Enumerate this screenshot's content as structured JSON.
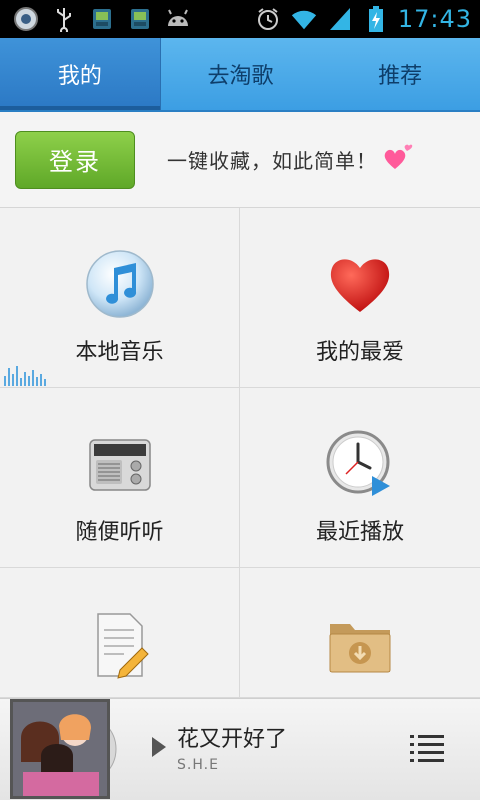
{
  "status_bar": {
    "time": "17:43",
    "left_icons": [
      "usb-debug-icon",
      "usb-icon",
      "android-app-icon",
      "android-app-icon",
      "android-icon"
    ],
    "right_icons": [
      "alarm-icon",
      "wifi-icon",
      "signal-icon",
      "battery-charging-icon"
    ]
  },
  "tabs": [
    {
      "label": "我的",
      "active": true
    },
    {
      "label": "去淘歌",
      "active": false
    },
    {
      "label": "推荐",
      "active": false
    }
  ],
  "login": {
    "button_label": "登录",
    "slogan": "一键收藏，如此简单！"
  },
  "grid": [
    {
      "label": "本地音乐",
      "icon": "music-note-icon"
    },
    {
      "label": "我的最爱",
      "icon": "heart-icon"
    },
    {
      "label": "随便听听",
      "icon": "radio-icon"
    },
    {
      "label": "最近播放",
      "icon": "clock-play-icon"
    },
    {
      "label": "",
      "icon": "document-edit-icon"
    },
    {
      "label": "",
      "icon": "download-folder-icon"
    }
  ],
  "player": {
    "song_title": "花又开好了",
    "artist": "S.H.E"
  },
  "colors": {
    "tab_bg": "#4aa8e9",
    "tab_active": "#2e7fc9",
    "login_green": "#6cb431",
    "time_blue": "#33b5e5"
  }
}
